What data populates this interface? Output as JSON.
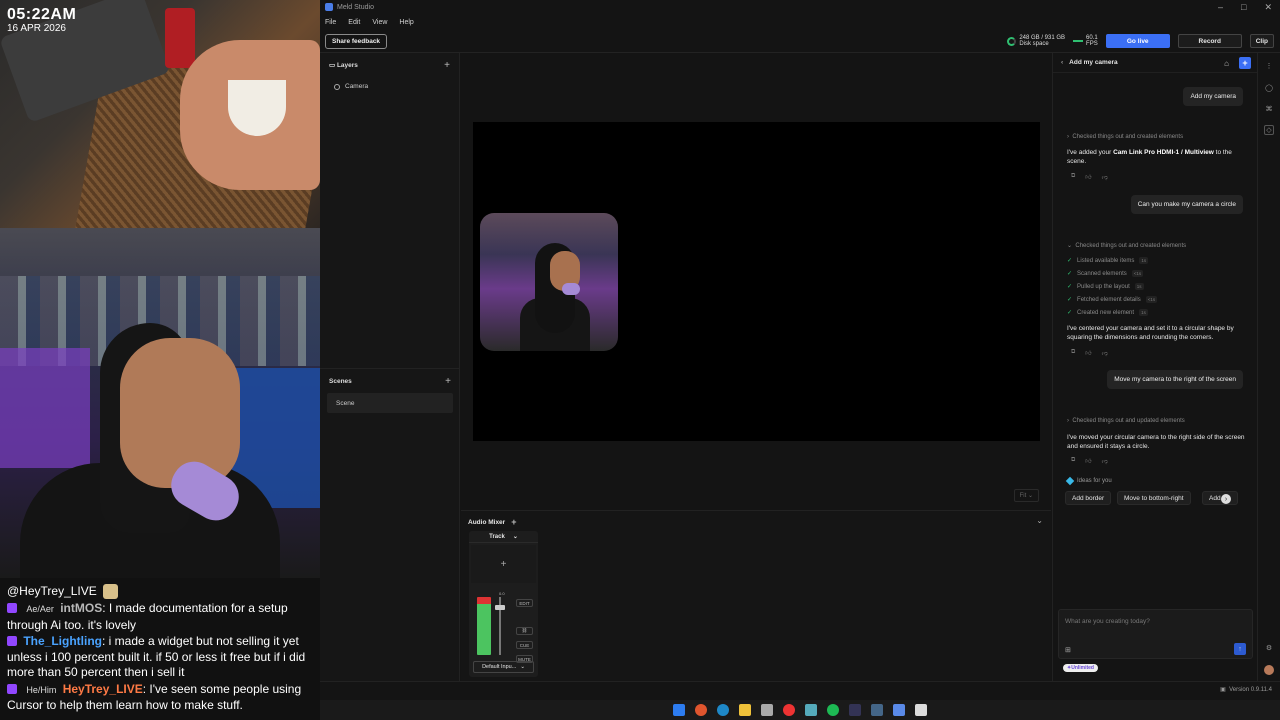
{
  "overlay": {
    "time": "05:22AM",
    "date": "16 APR 2026",
    "chat_header": "@HeyTrey_LIVE",
    "messages": [
      {
        "pronoun": "Ae/Aer",
        "user": "intMOS",
        "user_color": "#b9b9b9",
        "text": ": I made documentation for a setup through Ai too. it's lovely"
      },
      {
        "pronoun": "",
        "user": "The_Lightling",
        "user_color": "#4aa3ff",
        "text": ": i made a widget but not selling it yet unless i 100 percent built it. if 50 or less it free but if i did more than 50 percent then i sell it"
      },
      {
        "pronoun": "He/Him",
        "user": "HeyTrey_LIVE",
        "user_color": "#ff7a45",
        "text": ": I've seen some people using Cursor to help them learn how to make stuff."
      }
    ]
  },
  "app": {
    "title": "Meld Studio",
    "menu": [
      "File",
      "Edit",
      "View",
      "Help"
    ],
    "share_feedback": "Share feedback",
    "disk_value": "248 GB / 931 GB",
    "disk_label": "Disk space",
    "fps_value": "60.1",
    "fps_label": "FPS",
    "go_live": "Go live",
    "record": "Record",
    "clip": "Clip",
    "layers_title": "Layers",
    "layers": [
      "Camera"
    ],
    "scenes_title": "Scenes",
    "scenes": [
      "Scene"
    ],
    "fit_label": "Fit",
    "audio_title": "Audio Mixer",
    "track_label": "Track",
    "track_db": "0.0",
    "track_buttons": [
      "EDIT",
      "CUE",
      "MUTE"
    ],
    "track_input": "Default Inpu...",
    "version": "Version 0.9.11.4"
  },
  "assistant": {
    "title": "Add my camera",
    "user_msgs": [
      "Add my camera",
      "Can you make my camera a circle",
      "Move my camera to the right of the screen"
    ],
    "check1": "Checked things out and created elements",
    "reply1_pre": "I've added your ",
    "reply1_bold": "Cam Link Pro HDMI-1 / Multiview",
    "reply1_post": " to the scene.",
    "check2": "Checked things out and created elements",
    "steps": [
      {
        "label": "Listed available items",
        "sec": "1s"
      },
      {
        "label": "Scanned elements",
        "sec": "<1s"
      },
      {
        "label": "Pulled up the layout",
        "sec": "1s"
      },
      {
        "label": "Fetched element details",
        "sec": "<1s"
      },
      {
        "label": "Created new element",
        "sec": "1s"
      }
    ],
    "reply2": "I've centered your camera and set it to a circular shape by squaring the dimensions and rounding the corners.",
    "check3": "Checked things out and updated elements",
    "reply3": "I've moved your circular camera to the right side of the screen and ensured it stays a circle.",
    "ideas_label": "Ideas for you",
    "ideas": [
      "Add border",
      "Move to bottom-right",
      "Add"
    ],
    "input_placeholder": "What are you creating today?",
    "plan": "Unlimited"
  }
}
